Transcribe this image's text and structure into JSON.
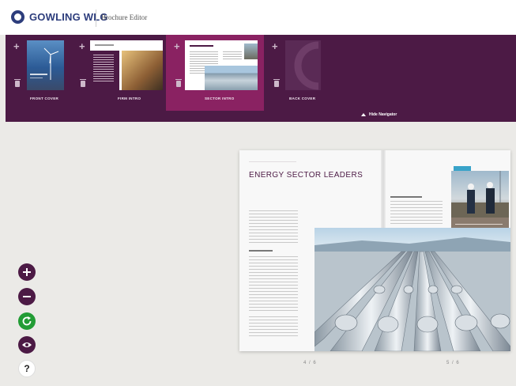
{
  "header": {
    "logo_text": "GOWLING WLG",
    "app_title": "Brochure Editor"
  },
  "navigator": {
    "pages": [
      {
        "label": "FRONT COVER",
        "active": false
      },
      {
        "label": "FIRM INTRO",
        "active": false
      },
      {
        "label": "SECTOR INTRO",
        "active": true
      },
      {
        "label": "BACK COVER",
        "active": false
      }
    ],
    "hide_label": "Hide Navigator"
  },
  "spread": {
    "title": "ENERGY SECTOR LEADERS",
    "page_left": "4 / 6",
    "page_right": "5 / 6"
  },
  "tools": [
    {
      "name": "zoom-in",
      "icon": "plus-icon"
    },
    {
      "name": "zoom-out",
      "icon": "minus-icon"
    },
    {
      "name": "refresh",
      "icon": "refresh-icon"
    },
    {
      "name": "preview",
      "icon": "eye-icon"
    },
    {
      "name": "help",
      "icon": "question-icon",
      "label": "?"
    }
  ],
  "colors": {
    "brand_navy": "#2d3d7c",
    "navigator_bg": "#4c1a45",
    "active_page": "#8a2262",
    "green_button": "#229c35"
  }
}
